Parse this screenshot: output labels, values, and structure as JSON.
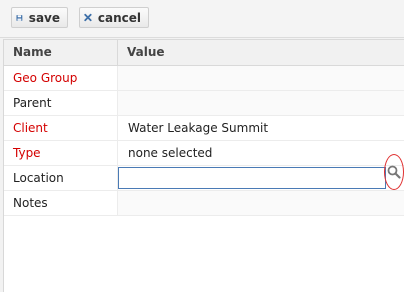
{
  "toolbar": {
    "save_label": "save",
    "cancel_label": "cancel"
  },
  "grid": {
    "columns": {
      "name": "Name",
      "value": "Value"
    },
    "rows": [
      {
        "name": "Geo Group",
        "value": "",
        "required": true
      },
      {
        "name": "Parent",
        "value": "",
        "required": false
      },
      {
        "name": "Client",
        "value": "Water Leakage Summit",
        "required": true
      },
      {
        "name": "Type",
        "value": "none selected",
        "required": true
      },
      {
        "name": "Location",
        "value": "",
        "required": false
      },
      {
        "name": "Notes",
        "value": "",
        "required": false
      }
    ]
  },
  "colors": {
    "required_label": "#d40000",
    "input_border": "#4a7ab5",
    "highlight_circle": "#e03030"
  }
}
